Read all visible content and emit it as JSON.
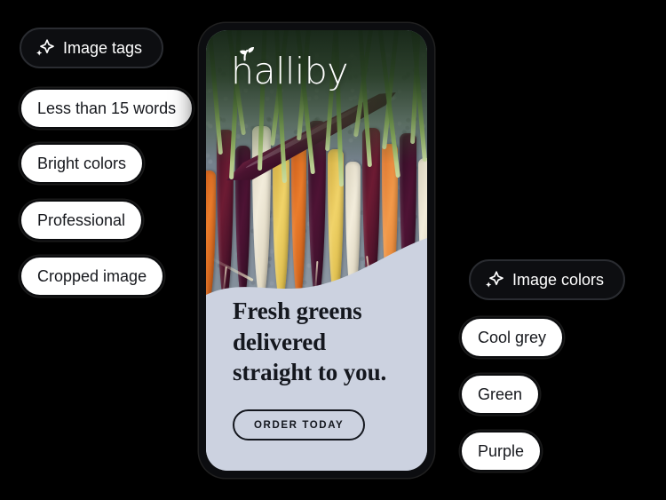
{
  "canvas": {
    "background": "#000000"
  },
  "left_group": {
    "header": {
      "label": "Image tags",
      "icon": "sparkle-icon"
    },
    "tags": [
      {
        "label": "Less than 15 words"
      },
      {
        "label": "Bright colors"
      },
      {
        "label": "Professional"
      },
      {
        "label": "Cropped image"
      }
    ]
  },
  "right_group": {
    "header": {
      "label": "Image colors",
      "icon": "sparkle-icon"
    },
    "tags": [
      {
        "label": "Cool grey"
      },
      {
        "label": "Green"
      },
      {
        "label": "Purple"
      }
    ]
  },
  "phone": {
    "brand": {
      "name": "halliby",
      "icon": "leaf-icon"
    },
    "image": {
      "alt": "rainbow carrots with green tops on grey stone",
      "dominant_colors": [
        "#8d9aa4",
        "#4e1334",
        "#ef9a4a",
        "#f0d369",
        "#f2ecdb",
        "#5d8a3c"
      ]
    },
    "panel": {
      "background": "#ccd2e0",
      "headline": "Fresh greens delivered straight to you.",
      "cta_label": "ORDER TODAY"
    }
  },
  "palette": {
    "pill_light_bg": "#ffffff",
    "pill_light_text": "#16181d",
    "pill_dark_bg": "#0d0e11",
    "pill_dark_text": "#ffffff",
    "panel_bg": "#ccd2e0",
    "ink": "#14171e"
  }
}
